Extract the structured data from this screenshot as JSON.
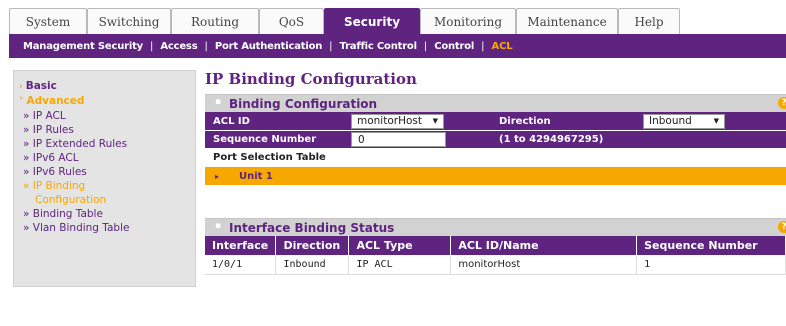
{
  "top_tabs": [
    {
      "label": "System",
      "active": false
    },
    {
      "label": "Switching",
      "active": false
    },
    {
      "label": "Routing",
      "active": false
    },
    {
      "label": "QoS",
      "active": false
    },
    {
      "label": "Security",
      "active": true
    },
    {
      "label": "Monitoring",
      "active": false
    },
    {
      "label": "Maintenance",
      "active": false
    },
    {
      "label": "Help",
      "active": false
    }
  ],
  "sub_tabs": [
    {
      "label": "Management Security",
      "active": false
    },
    {
      "label": "Access",
      "active": false
    },
    {
      "label": "Port Authentication",
      "active": false
    },
    {
      "label": "Traffic Control",
      "active": false
    },
    {
      "label": "Control",
      "active": false
    },
    {
      "label": "ACL",
      "active": true
    }
  ],
  "sidebar": {
    "basic": "Basic",
    "advanced": "Advanced",
    "items": [
      {
        "label": "IP ACL",
        "active": false
      },
      {
        "label": "IP Rules",
        "active": false
      },
      {
        "label": "IP Extended Rules",
        "active": false
      },
      {
        "label": "IPv6 ACL",
        "active": false
      },
      {
        "label": "IPv6 Rules",
        "active": false
      },
      {
        "label": "IP Binding",
        "active": true
      }
    ],
    "active_continuation": "Configuration",
    "tail_items": [
      {
        "label": "Binding Table"
      },
      {
        "label": "Vlan Binding Table"
      }
    ]
  },
  "page": {
    "title": "IP Binding Configuration",
    "binding": {
      "title": "Binding Configuration",
      "acl_id_label": "ACL ID",
      "acl_id_value": "monitorHost",
      "direction_label": "Direction",
      "direction_value": "Inbound",
      "sequence_label": "Sequence Number",
      "sequence_value": "0",
      "sequence_hint": "(1 to 4294967295)",
      "port_selection_label": "Port Selection Table",
      "unit_label": "Unit 1"
    },
    "status": {
      "title": "Interface Binding Status",
      "columns": [
        "Interface",
        "Direction",
        "ACL Type",
        "ACL ID/Name",
        "Sequence Number"
      ],
      "rows": [
        [
          "1/0/1",
          "Inbound",
          "IP ACL",
          "monitorHost",
          "1"
        ]
      ]
    },
    "help_glyph": "?"
  },
  "colors": {
    "purple": "#5e247f",
    "orange": "#f6a800",
    "header_gray": "#d2d2d2"
  },
  "icons": {
    "caret": "arrow-right-icon",
    "help": "help-icon",
    "dropdown": "chevron-down-icon"
  }
}
